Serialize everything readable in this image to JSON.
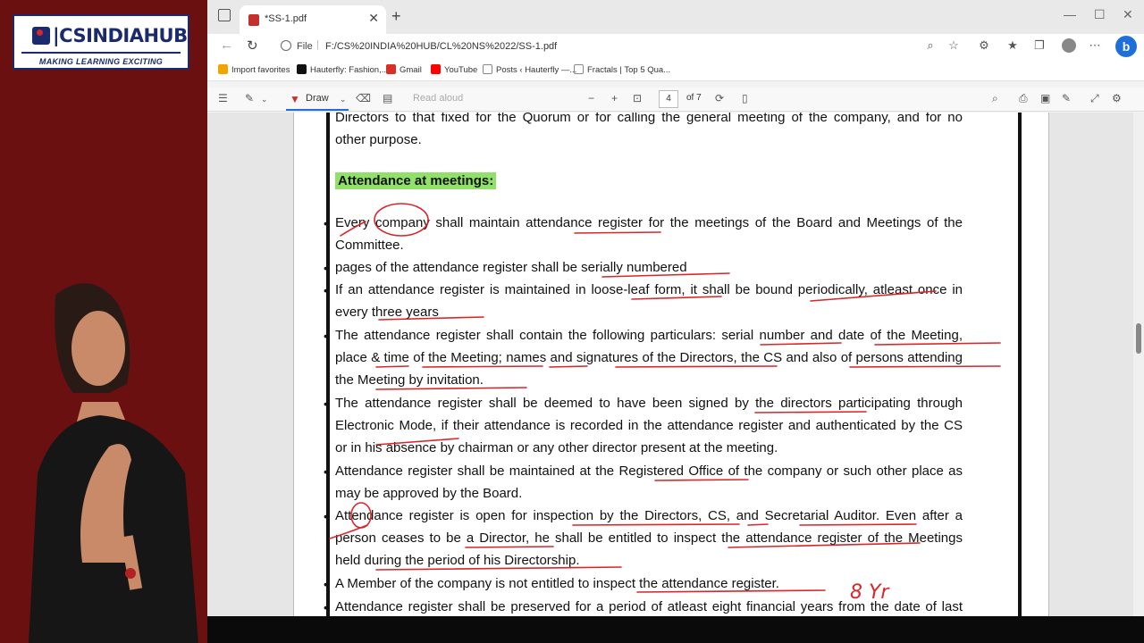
{
  "logo": {
    "brand": "CSINDIAHUB",
    "tagline": "MAKING LEARNING EXCITING"
  },
  "browser": {
    "tab_title": "*SS-1.pdf",
    "tab_close": "✕",
    "new_tab": "+",
    "window_controls": [
      "—",
      "☐",
      "✕"
    ],
    "address": {
      "file_label": "File",
      "separator": "|",
      "url": "F:/CS%20INDIA%20HUB/CL%20NS%2022/SS-1.pdf"
    },
    "favorites": [
      {
        "label": "Import favorites",
        "icon": "folder-icon",
        "color": "#f0a500"
      },
      {
        "label": "Hauterfly: Fashion,...",
        "icon": "h-logo-icon",
        "color": "#111111"
      },
      {
        "label": "Gmail",
        "icon": "gmail-icon",
        "color": "#d93025"
      },
      {
        "label": "YouTube",
        "icon": "youtube-icon",
        "color": "#ff0000"
      },
      {
        "label": "Posts ‹ Hauterfly —...",
        "icon": "page-icon",
        "color": "#888888"
      },
      {
        "label": "Fractals | Top 5 Qua...",
        "icon": "page-icon",
        "color": "#888888"
      }
    ],
    "pdf_toolbar": {
      "draw_label": "Draw",
      "read_aloud": "Read aloud",
      "current_page": "4",
      "page_total": "of 7",
      "zoom_out": "−",
      "zoom_in": "+"
    },
    "bing_label": "b"
  },
  "document": {
    "intro_lines": [
      "Directors to that fixed for the Quorum or for calling the general meeting of the company, and for no",
      "other purpose."
    ],
    "heading": "Attendance at meetings:",
    "bullet_char": "•",
    "bullets": [
      {
        "lines": [
          "Every company shall maintain attendance register for the meetings of the Board and Meetings of the",
          "Committee."
        ]
      },
      {
        "lines": [
          "pages of the attendance register shall be serially numbered"
        ]
      },
      {
        "lines": [
          "If an attendance register is maintained in loose-leaf form, it shall be bound periodically, atleast once in",
          "every three years"
        ]
      },
      {
        "lines": [
          "The attendance register shall contain the following particulars: serial number and date of the Meeting,",
          "place & time of the Meeting; names and signatures of the Directors, the CS and also of persons attending",
          "the Meeting by invitation."
        ]
      },
      {
        "lines": [
          "The attendance register shall be deemed to have been signed by the directors participating through",
          "Electronic Mode, if their attendance is recorded in the attendance register and authenticated by the CS",
          "or in his absence by chairman or any other director present at the meeting."
        ]
      },
      {
        "lines": [
          "Attendance register shall be maintained at the Registered Office of the company or such other place as",
          "may be approved by the Board."
        ]
      },
      {
        "lines": [
          "Attendance register is open for inspection by the Directors, CS, and Secretarial Auditor. Even after a",
          "person ceases to be a Director, he shall be entitled to inspect the attendance register of the Meetings",
          "held during the period of his Directorship."
        ]
      },
      {
        "lines": [
          "A Member of the company is not entitled to inspect the attendance register."
        ]
      },
      {
        "lines": [
          "Attendance register shall be preserved for a period of atleast eight financial years from the date of last"
        ]
      }
    ],
    "handwritten_note": "8 Yr"
  },
  "colors": {
    "background": "#5a0e0e",
    "highlight": "#90e06a",
    "ink": "#d8262b",
    "accent": "#1e6fd9"
  }
}
